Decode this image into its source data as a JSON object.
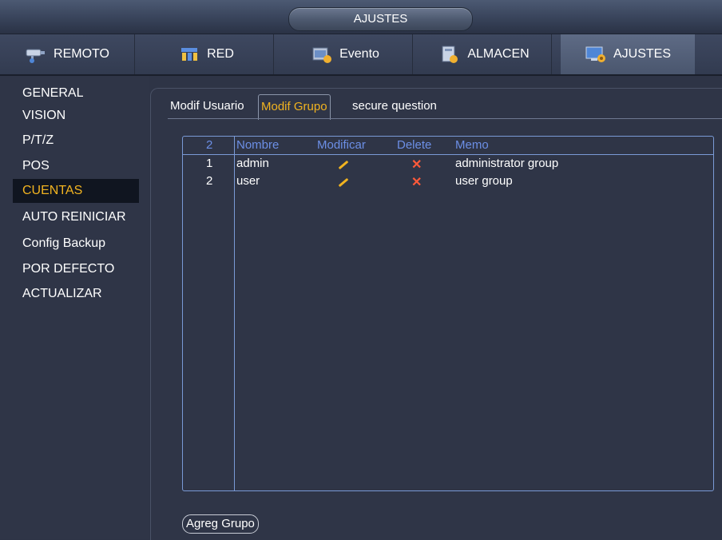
{
  "window": {
    "title": "AJUSTES"
  },
  "topnav": {
    "tabs": [
      {
        "label": "REMOTO",
        "icon": "camera-icon",
        "active": false
      },
      {
        "label": "RED",
        "icon": "network-icon",
        "active": false
      },
      {
        "label": "Evento",
        "icon": "event-icon",
        "active": false
      },
      {
        "label": "ALMACEN",
        "icon": "storage-icon",
        "active": false
      },
      {
        "label": "AJUSTES",
        "icon": "settings-icon",
        "active": true
      }
    ]
  },
  "sidebar": {
    "items": [
      {
        "label": "GENERAL",
        "active": false
      },
      {
        "label": "VISION",
        "active": false
      },
      {
        "label": "P/T/Z",
        "active": false
      },
      {
        "label": "POS",
        "active": false
      },
      {
        "label": "CUENTAS",
        "active": true
      },
      {
        "label": "AUTO REINICIAR",
        "active": false
      },
      {
        "label": "Config Backup",
        "active": false
      },
      {
        "label": "POR DEFECTO",
        "active": false
      },
      {
        "label": "ACTUALIZAR",
        "active": false
      }
    ]
  },
  "subtabs": [
    {
      "label": "Modif Usuario",
      "active": false
    },
    {
      "label": "Modif Grupo",
      "active": true
    },
    {
      "label": "secure question",
      "active": false
    }
  ],
  "table": {
    "count": "2",
    "headers": {
      "name": "Nombre",
      "modify": "Modificar",
      "delete": "Delete",
      "memo": "Memo"
    },
    "rows": [
      {
        "index": "1",
        "name": "admin",
        "memo": "administrator group"
      },
      {
        "index": "2",
        "name": "user",
        "memo": "user group"
      }
    ]
  },
  "actions": {
    "add_group_label": "Agreg Grupo"
  },
  "colors": {
    "accent": "#f1b320",
    "header": "#6c8fe6",
    "delete": "#ff5a3a"
  }
}
